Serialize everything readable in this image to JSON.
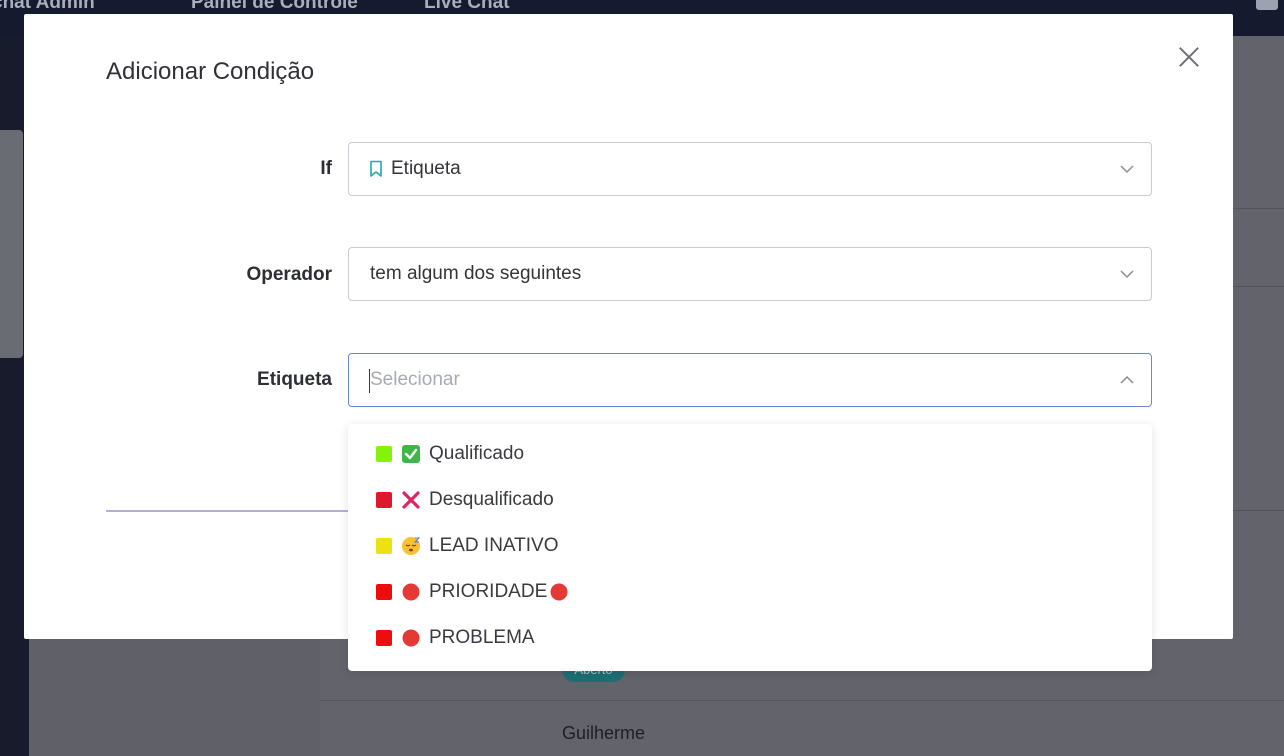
{
  "background": {
    "nav": [
      "chat Admin",
      "Painel de Controle",
      "Live Chat"
    ],
    "badge": "Aberto",
    "row_name": "Guilherme"
  },
  "modal": {
    "title": "Adicionar Condição",
    "fields": [
      {
        "label": "If",
        "value": "Etiqueta",
        "icon": "bookmark-icon"
      },
      {
        "label": "Operador",
        "value": "tem algum dos seguintes"
      },
      {
        "label": "Etiqueta",
        "placeholder": "Selecionar"
      }
    ]
  },
  "dropdown": {
    "options": [
      {
        "label": "Qualificado",
        "color": "#84f20d",
        "emoji": "check-mark-button-icon"
      },
      {
        "label": "Desqualificado",
        "color": "#dc1a2b",
        "emoji": "cross-mark-icon"
      },
      {
        "label": "LEAD INATIVO",
        "color": "#ece111",
        "emoji": "sleeping-face-icon"
      },
      {
        "label": "PRIORIDADE",
        "color": "#ee0d0d",
        "emoji": "red-circle-icon",
        "trailing_emoji": "red-circle-icon"
      },
      {
        "label": "PROBLEMA",
        "color": "#ee0d0d",
        "emoji": "red-circle-icon"
      }
    ]
  },
  "colors": {
    "accent_border": "#6b88c9",
    "bookmark": "#2aa7a7"
  }
}
